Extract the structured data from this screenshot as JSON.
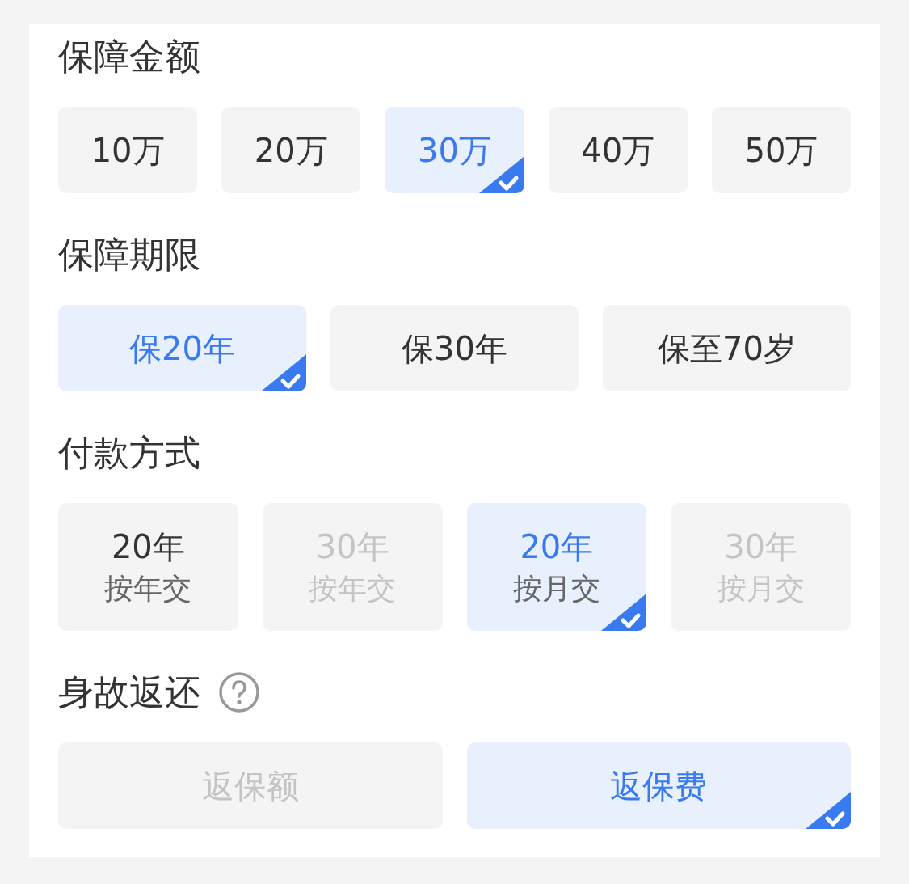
{
  "sections": [
    {
      "title": "保障金额",
      "help_icon": false,
      "options": [
        {
          "label": "10万",
          "selected": false,
          "disabled": false
        },
        {
          "label": "20万",
          "selected": false,
          "disabled": false
        },
        {
          "label": "30万",
          "selected": true,
          "disabled": false
        },
        {
          "label": "40万",
          "selected": false,
          "disabled": false
        },
        {
          "label": "50万",
          "selected": false,
          "disabled": false
        }
      ]
    },
    {
      "title": "保障期限",
      "help_icon": false,
      "options": [
        {
          "label": "保20年",
          "selected": true,
          "disabled": false
        },
        {
          "label": "保30年",
          "selected": false,
          "disabled": false
        },
        {
          "label": "保至70岁",
          "selected": false,
          "disabled": false
        }
      ]
    },
    {
      "title": "付款方式",
      "help_icon": false,
      "options": [
        {
          "label": "20年",
          "sublabel": "按年交",
          "selected": false,
          "disabled": false
        },
        {
          "label": "30年",
          "sublabel": "按年交",
          "selected": false,
          "disabled": true
        },
        {
          "label": "20年",
          "sublabel": "按月交",
          "selected": true,
          "disabled": false
        },
        {
          "label": "30年",
          "sublabel": "按月交",
          "selected": false,
          "disabled": true
        }
      ]
    },
    {
      "title": "身故返还",
      "help_icon": true,
      "options": [
        {
          "label": "返保额",
          "selected": false,
          "disabled": true
        },
        {
          "label": "返保费",
          "selected": true,
          "disabled": false
        }
      ]
    }
  ]
}
